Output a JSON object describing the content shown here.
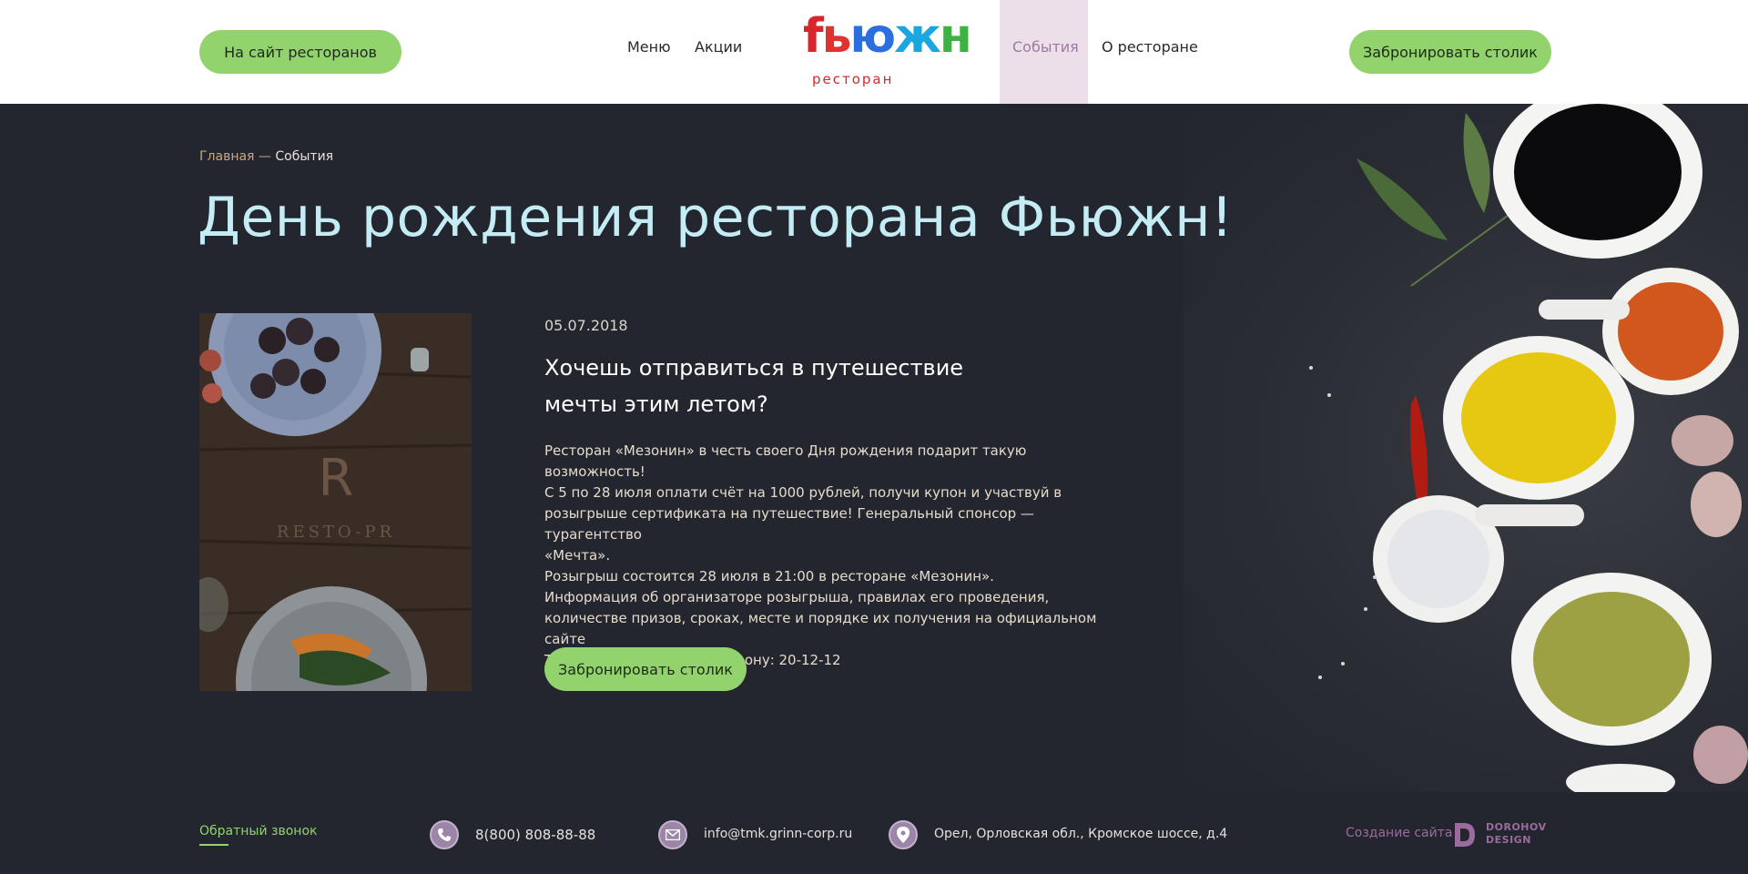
{
  "header": {
    "sites_button": "На сайт ресторанов",
    "nav": {
      "menu": "Меню",
      "promo": "Акции",
      "events": "События",
      "about": "О ресторане"
    },
    "logo": {
      "main": "fьюжн",
      "sub": "ресторан"
    },
    "book_button": "Забронировать столик"
  },
  "breadcrumb": {
    "home": "Главная",
    "separator": " — ",
    "current": "События"
  },
  "page_title": "День рождения ресторана Фьюжн!",
  "event": {
    "photo_watermark": "RESTO-PR",
    "date": "05.07.2018",
    "heading_line1": "Хочешь отправиться в путешествие",
    "heading_line2": "мечты этим летом?",
    "body": [
      "Ресторан «Мезонин» в честь своего Дня рождения подарит такую возможность!",
      "С 5 по 28 июля оплати счёт на 1000 рублей, получи купон и участвуй в",
      "розыгрыше сертификата на путешествие! Генеральный спонсор — турагентство",
      "«Мечта».",
      "Розыгрыш состоится 28 июля в 21:00 в ресторане «Мезонин».",
      "Информация об организаторе розыгрыша, правилах его проведения,",
      "количестве призов, сроках, месте и порядке их получения на официальном сайте",
      "ТМК «ГРИНН» или по телефону: 20-12-12"
    ],
    "book_button": "Забронировать столик"
  },
  "footer": {
    "callback": "Обратный звонок",
    "phone": "8(800) 808-88-88",
    "email": "info@tmk.grinn-corp.ru",
    "address": "Орел, Орловская обл., Кромское шоссе, д.4",
    "credit": "Создание сайта -",
    "credit_brand_line1": "DOROHOV",
    "credit_brand_line2": "DESIGN"
  },
  "colors": {
    "accent_green": "#93d36e",
    "title_blue": "#c3ecf4",
    "background_dark": "#23252f",
    "active_nav_bg": "#ecdfe9",
    "footer_icon": "#9c86a8"
  },
  "icons": [
    "phone-icon",
    "mail-icon",
    "location-pin-icon",
    "dorohov-logo-icon"
  ]
}
